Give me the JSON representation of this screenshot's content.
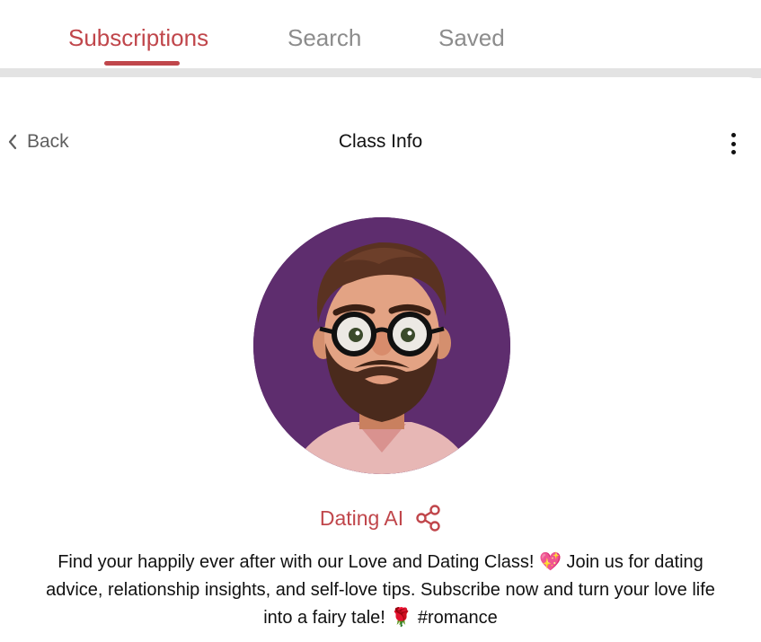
{
  "tabs": [
    {
      "label": "Subscriptions",
      "active": true
    },
    {
      "label": "Search",
      "active": false
    },
    {
      "label": "Saved",
      "active": false
    }
  ],
  "header": {
    "back_label": "Back",
    "title": "Class Info"
  },
  "class": {
    "name": "Dating AI",
    "description_line1": "Find your happily ever after with our Love and Dating Class! 💖  Join us for dating",
    "description_line2": "advice, relationship insights, and self-love tips. Subscribe now and turn your love life",
    "description_line3": "into a fairy tale! 🌹  #romance"
  },
  "colors": {
    "accent": "#c0464b",
    "avatar_bg": "#5e2d6e",
    "inactive_tab": "#8c8c8c"
  },
  "icons": {
    "back": "chevron-left-icon",
    "menu": "more-vertical-icon",
    "share": "share-icon"
  }
}
